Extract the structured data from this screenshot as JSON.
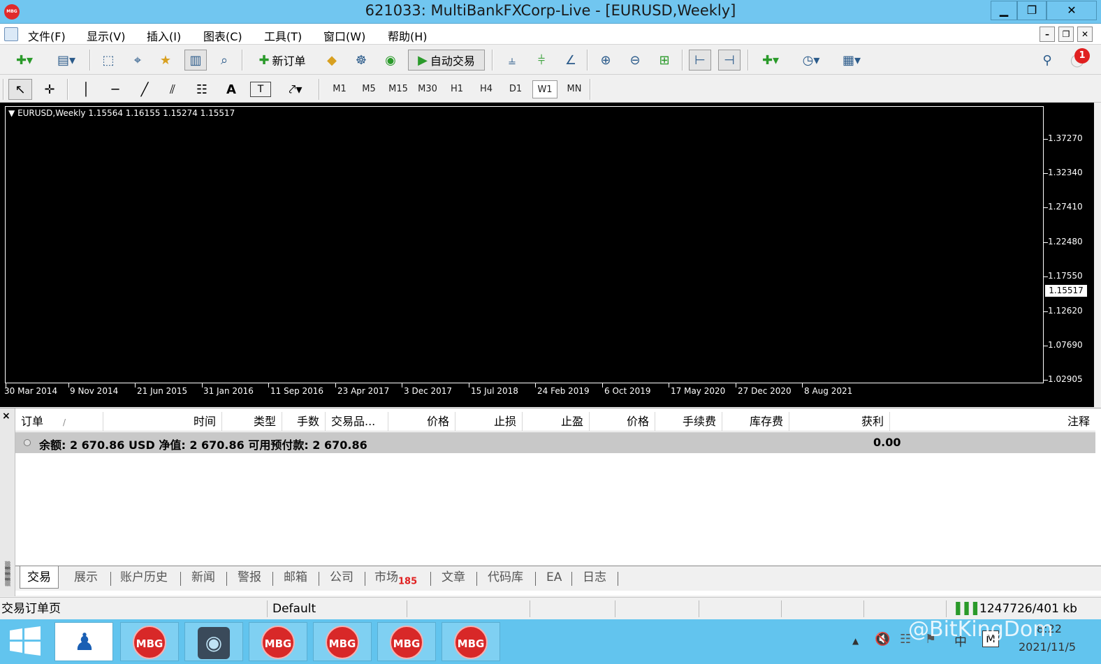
{
  "window": {
    "title": "621033: MultiBankFXCorp-Live - [EURUSD,Weekly]",
    "logo_text": "MBG",
    "minimize": "▁",
    "restore": "❐",
    "close": "✕"
  },
  "menu": {
    "items": [
      "文件(F)",
      "显示(V)",
      "插入(I)",
      "图表(C)",
      "工具(T)",
      "窗口(W)",
      "帮助(H)"
    ],
    "mdi_minimize": "–",
    "mdi_restore": "❐",
    "mdi_close": "✕"
  },
  "toolbar": {
    "new_order": "新订单",
    "auto_trading": "自动交易",
    "notification_count": "1"
  },
  "drawing_tools": {
    "text_tool": "A",
    "label_tool": "T"
  },
  "timeframes": {
    "items": [
      "M1",
      "M5",
      "M15",
      "M30",
      "H1",
      "H4",
      "D1",
      "W1",
      "MN"
    ],
    "active": "W1"
  },
  "chart": {
    "header": "EURUSD,Weekly  1.15564 1.16155 1.15274 1.15517",
    "price_labels": [
      "1.37270",
      "1.32340",
      "1.27410",
      "1.22480",
      "1.17550",
      "1.12620",
      "1.07690",
      "1.02905"
    ],
    "current_price": "1.15517",
    "date_labels": [
      "30 Mar 2014",
      "9 Nov 2014",
      "21 Jun 2015",
      "31 Jan 2016",
      "11 Sep 2016",
      "23 Apr 2017",
      "3 Dec 2017",
      "15 Jul 2018",
      "24 Feb 2019",
      "6 Oct 2019",
      "17 May 2020",
      "27 Dec 2020",
      "8 Aug 2021"
    ]
  },
  "terminal": {
    "close": "×",
    "columns": [
      "订单",
      "时间",
      "类型",
      "手数",
      "交易品...",
      "价格",
      "止损",
      "止盈",
      "价格",
      "手续费",
      "库存费",
      "获利",
      "注释"
    ],
    "sort_marker": "/",
    "balance_text": "余额: 2 670.86 USD  净值: 2 670.86  可用预付款: 2 670.86",
    "profit_total": "0.00",
    "tabs": [
      "交易",
      "展示",
      "账户历史",
      "新闻",
      "警报",
      "邮箱",
      "公司",
      "市场",
      "文章",
      "代码库",
      "EA",
      "日志"
    ],
    "market_badge": "185",
    "active_tab": "交易"
  },
  "statusbar": {
    "left": "交易订单页",
    "profile": "Default",
    "traffic": "1247726/401 kb"
  },
  "taskbar": {
    "mbg_label": "MBG",
    "ime": "中",
    "ime_mode": "M",
    "time": "8:22",
    "date": "2021/11/5",
    "watermark": "@BitKingDom"
  }
}
